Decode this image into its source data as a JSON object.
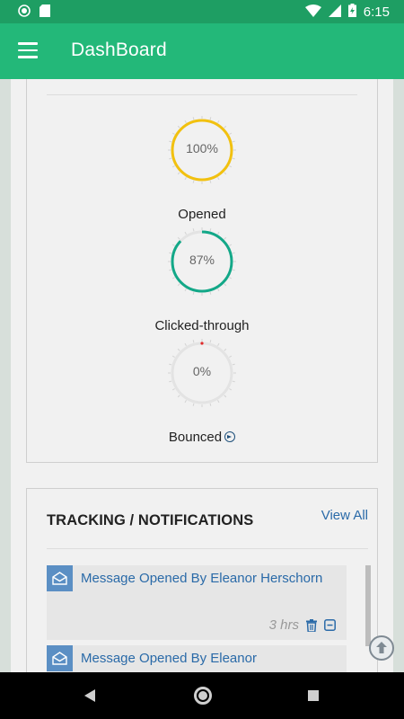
{
  "status_bar": {
    "time": "6:15",
    "icons": [
      "sync-icon",
      "sd-card-icon",
      "wifi-icon",
      "signal-icon",
      "battery-charging-icon"
    ]
  },
  "app_bar": {
    "title": "DashBoard",
    "menu_icon": "hamburger-menu-icon"
  },
  "stats": {
    "gauges": [
      {
        "value_text": "100%",
        "fraction": 1.0,
        "color": "#f2c10f",
        "label": "Opened"
      },
      {
        "value_text": "87%",
        "fraction": 0.87,
        "color": "#13a888",
        "label": "Clicked-through"
      },
      {
        "value_text": "0%",
        "fraction": 0.0,
        "color": "#e02a2a",
        "label": "Bounced"
      }
    ],
    "bounced_icon": "arrow-circle-right-icon"
  },
  "tracking": {
    "heading": "TRACKING / NOTIFICATIONS",
    "view_all": "View All",
    "items": [
      {
        "message": "Message Opened By Eleanor Herschorn",
        "time": "3 hrs"
      },
      {
        "message": "Message Opened By Eleanor",
        "time": ""
      }
    ]
  },
  "colors": {
    "app_bar": "#23b879",
    "status_bar": "#1e9e63",
    "link": "#2a6aa8",
    "envelope": "#5b8fc4"
  },
  "scroll_top_icon": "arrow-up-circle-icon",
  "nav_bar": {
    "icons": [
      "back-icon",
      "home-icon",
      "recent-apps-icon"
    ]
  }
}
